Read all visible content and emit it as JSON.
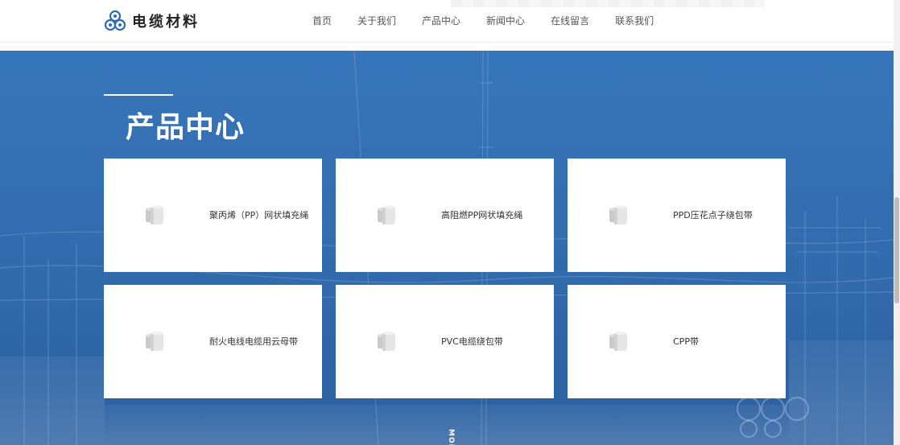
{
  "header": {
    "logo_text": "电缆材料",
    "nav": [
      {
        "label": "首页"
      },
      {
        "label": "关于我们"
      },
      {
        "label": "产品中心"
      },
      {
        "label": "新闻中心"
      },
      {
        "label": "在线留言"
      },
      {
        "label": "联系我们"
      }
    ]
  },
  "products": {
    "title": "产品中心",
    "items": [
      {
        "label": "聚丙烯（PP）网状填充绳"
      },
      {
        "label": "高阻燃PP网状填充绳"
      },
      {
        "label": "PPD压花点子绕包带"
      },
      {
        "label": "耐火电线电缆用云母带"
      },
      {
        "label": "PVC电缆绕包带"
      },
      {
        "label": "CPP带"
      }
    ],
    "more_label": "MORE"
  },
  "colors": {
    "section_blue": "#3775ba",
    "card_bg": "#ffffff",
    "logo_blue": "#2c6db5"
  }
}
